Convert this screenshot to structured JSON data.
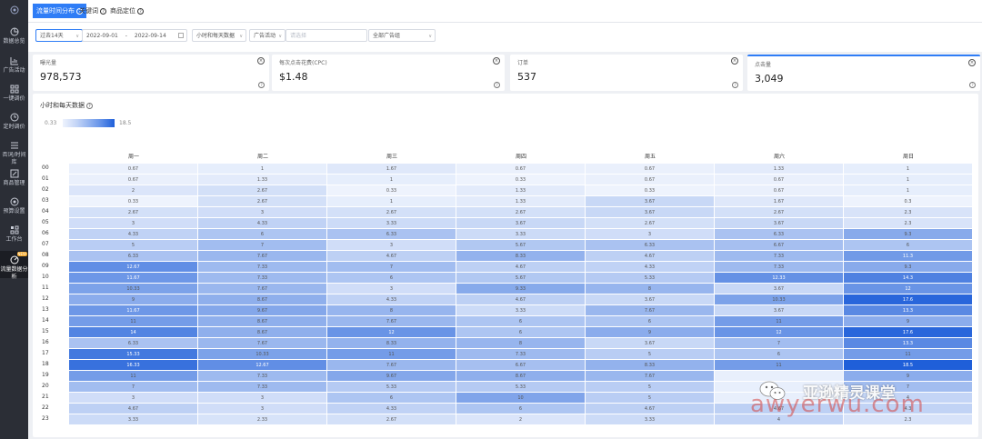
{
  "sidebar": {
    "items": [
      {
        "label": "",
        "icon": "home-icon"
      },
      {
        "label": "数据总览",
        "icon": "pie-chart-icon"
      },
      {
        "label": "广告活动",
        "icon": "bar-chart-icon"
      },
      {
        "label": "一键调价",
        "icon": "grid-icon"
      },
      {
        "label": "定时调价",
        "icon": "clock-icon"
      },
      {
        "label": "否词/时间库",
        "icon": "list-icon"
      },
      {
        "label": "商品管理",
        "icon": "edit-icon"
      },
      {
        "label": "预算设置",
        "icon": "target-icon"
      },
      {
        "label": "工作台",
        "icon": "apps-icon"
      },
      {
        "label": "流量数据分析",
        "icon": "radar-icon",
        "badge": "NEW"
      }
    ]
  },
  "tabs": [
    {
      "label": "流量时间分布"
    },
    {
      "label": "关键词"
    },
    {
      "label": "商品定位"
    }
  ],
  "filters": {
    "range": "过去14天",
    "date_start": "2022-09-01",
    "sep": "-",
    "date_end": "2022-09-14",
    "granularity": "小时和每天数据",
    "campaign": "广告活动",
    "group_placeholder": "请选择",
    "portfolio": "全部广告组"
  },
  "metrics": [
    {
      "label": "曝光量",
      "value": "978,573"
    },
    {
      "label": "每次点击花费(CPC)",
      "value": "$1.48"
    },
    {
      "label": "订单",
      "value": "537"
    },
    {
      "label": "点击量",
      "value": "3,049"
    }
  ],
  "panel": {
    "title": "小时和每天数据",
    "legend_min": "0.33",
    "legend_max": "18.5"
  },
  "chart_data": {
    "type": "heatmap",
    "columns": [
      "周一",
      "周二",
      "周三",
      "周四",
      "周五",
      "周六",
      "周日"
    ],
    "rows": [
      "00",
      "01",
      "02",
      "03",
      "04",
      "05",
      "06",
      "07",
      "08",
      "09",
      "10",
      "11",
      "12",
      "13",
      "14",
      "15",
      "16",
      "17",
      "18",
      "19",
      "20",
      "21",
      "22",
      "23"
    ],
    "values": [
      [
        "0.67",
        "1",
        "1.67",
        "0.67",
        "0.67",
        "1.33",
        "1"
      ],
      [
        "0.67",
        "1.33",
        "1",
        "0.33",
        "0.67",
        "0.67",
        "1"
      ],
      [
        "2",
        "2.67",
        "0.33",
        "1.33",
        "0.33",
        "0.67",
        "1"
      ],
      [
        "0.33",
        "2.67",
        "1",
        "1.33",
        "3.67",
        "1.67",
        "0.3"
      ],
      [
        "2.67",
        "3",
        "2.67",
        "2.67",
        "3.67",
        "2.67",
        "2.3"
      ],
      [
        "3",
        "4.33",
        "3.33",
        "3.67",
        "2.67",
        "3.67",
        "2.3"
      ],
      [
        "4.33",
        "6",
        "6.33",
        "3.33",
        "3",
        "6.33",
        "9.3"
      ],
      [
        "5",
        "7",
        "3",
        "5.67",
        "6.33",
        "6.67",
        "6"
      ],
      [
        "6.33",
        "7.67",
        "4.67",
        "8.33",
        "4.67",
        "7.33",
        "11.3"
      ],
      [
        "12.67",
        "7.33",
        "7",
        "4.67",
        "4.33",
        "7.33",
        "9.3"
      ],
      [
        "11.67",
        "7.33",
        "6",
        "5.67",
        "5.33",
        "12.33",
        "14.3"
      ],
      [
        "10.33",
        "7.67",
        "3",
        "9.33",
        "8",
        "3.67",
        "12"
      ],
      [
        "9",
        "8.67",
        "4.33",
        "4.67",
        "3.67",
        "10.33",
        "17.6"
      ],
      [
        "11.67",
        "9.67",
        "8",
        "3.33",
        "7.67",
        "3.67",
        "13.3"
      ],
      [
        "11",
        "8.67",
        "7.67",
        "6",
        "6",
        "11",
        "9"
      ],
      [
        "14",
        "8.67",
        "12",
        "6",
        "9",
        "12",
        "17.6"
      ],
      [
        "6.33",
        "7.67",
        "8.33",
        "8",
        "3.67",
        "7",
        "13.3"
      ],
      [
        "15.33",
        "10.33",
        "11",
        "7.33",
        "5",
        "6",
        "11"
      ],
      [
        "16.33",
        "12.67",
        "7.67",
        "6.67",
        "8.33",
        "11",
        "18.5"
      ],
      [
        "11",
        "7.33",
        "9.67",
        "8.67",
        "7.67",
        "",
        "9"
      ],
      [
        "7",
        "7.33",
        "5.33",
        "5.33",
        "5",
        "",
        "7"
      ],
      [
        "3",
        "3",
        "6",
        "10",
        "5",
        "",
        "4"
      ],
      [
        "4.67",
        "3",
        "4.33",
        "6",
        "4.67",
        "4.67",
        "4.3"
      ],
      [
        "3.33",
        "2.33",
        "2.67",
        "2",
        "3.33",
        "4",
        "2.3"
      ]
    ],
    "min": 0.33,
    "max": 18.5
  },
  "watermark": {
    "cn": "亚逊精灵课堂",
    "en": "awyerwu.com"
  },
  "colors": {
    "accent": "#2f7df6",
    "sidebar_bg": "#2b2e36",
    "heat_low": "#eef3fd",
    "heat_high": "#1f5fd9"
  }
}
